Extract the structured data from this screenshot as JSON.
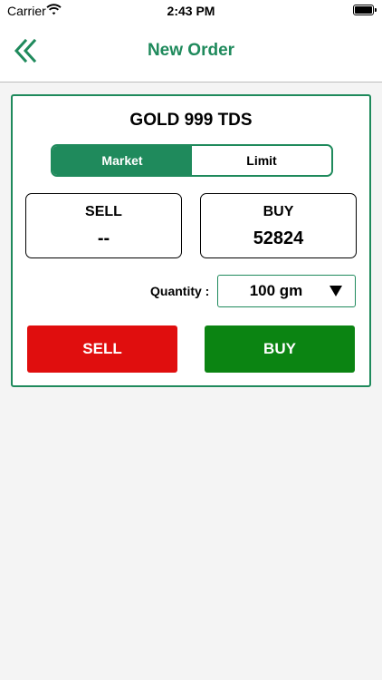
{
  "status_bar": {
    "carrier": "Carrier",
    "time": "2:43 PM",
    "icons": [
      "wifi-icon",
      "battery-icon"
    ]
  },
  "nav": {
    "title": "New Order",
    "back_icon": "double-chevron-left-icon"
  },
  "order": {
    "symbol": "GOLD 999 TDS",
    "tabs": [
      {
        "label": "Market",
        "active": true
      },
      {
        "label": "Limit",
        "active": false
      }
    ],
    "sell_box": {
      "label": "SELL",
      "value": "--"
    },
    "buy_box": {
      "label": "BUY",
      "value": "52824"
    },
    "quantity": {
      "label": "Quantity :",
      "selected": "100 gm",
      "icon": "dropdown-triangle-icon"
    },
    "actions": {
      "sell_label": "SELL",
      "buy_label": "BUY"
    }
  },
  "colors": {
    "accent": "#1f8a5c",
    "sell_button": "#e00e0e",
    "buy_button": "#0b8412",
    "background": "#f4f4f4"
  }
}
